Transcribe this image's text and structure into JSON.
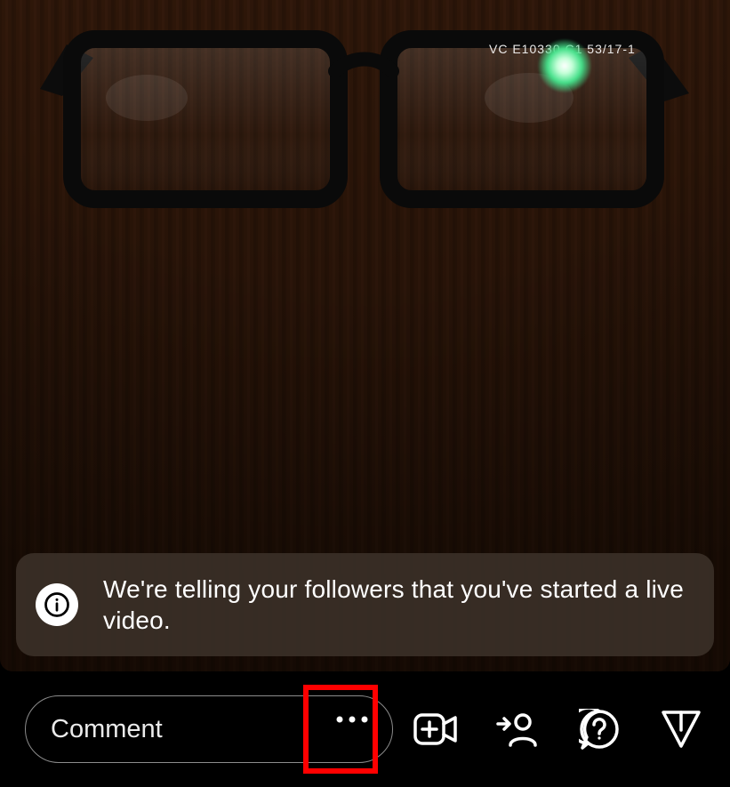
{
  "banner": {
    "message": "We're telling your followers that you've started a live video."
  },
  "bottom": {
    "comment_placeholder": "Comment",
    "icons": {
      "more": "more-options-icon",
      "add_video": "add-video-icon",
      "add_guest": "add-guest-icon",
      "questions": "questions-icon",
      "send": "send-icon"
    }
  }
}
